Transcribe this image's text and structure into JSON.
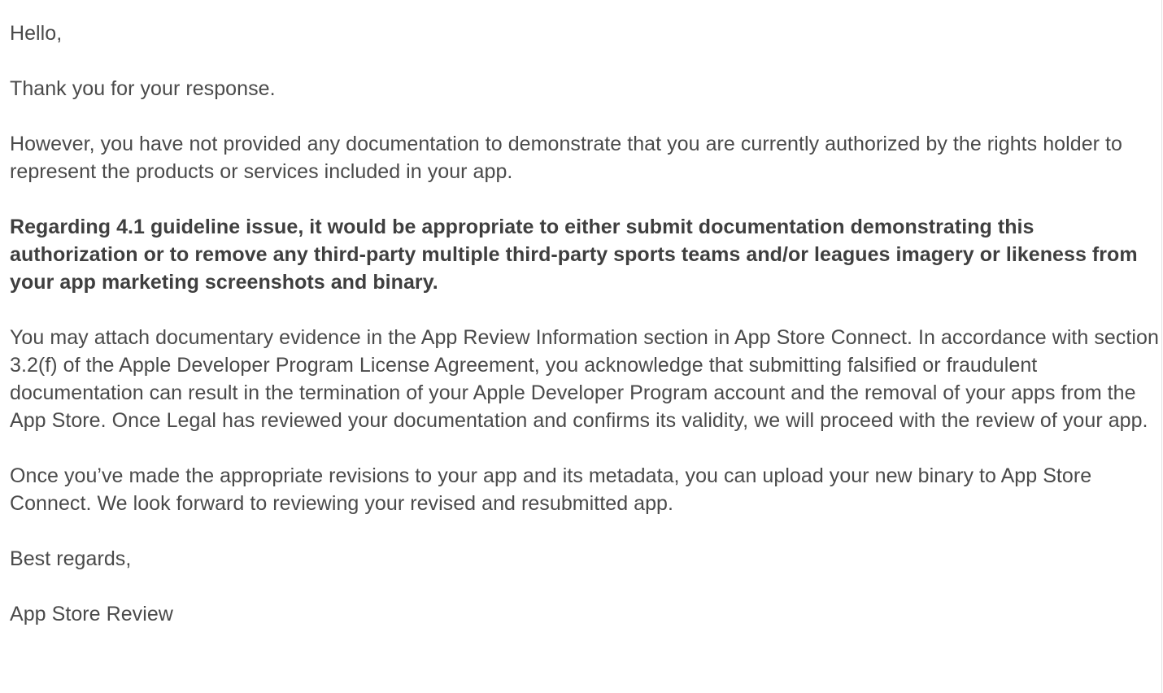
{
  "message": {
    "greeting": "Hello,",
    "thanks": "Thank you for your response.",
    "no_documentation": "However, you have not provided any documentation to demonstrate that you are currently authorized by the rights holder to represent the products or services included in your app.",
    "guideline_issue": "Regarding 4.1 guideline issue, it would be appropriate to either submit documentation demonstrating this authorization or to remove any third-party multiple third-party sports teams and/or leagues imagery or likeness from your app marketing screenshots and binary.",
    "attach_evidence": "You may attach documentary evidence in the App Review Information section in App Store Connect. In accordance with section 3.2(f) of the Apple Developer Program License Agreement, you acknowledge that submitting falsified or fraudulent documentation can result in the termination of your Apple Developer Program account and the removal of your apps from the App Store. Once Legal has reviewed your documentation and confirms its validity, we will proceed with the review of your app.",
    "revisions": "Once you’ve made the appropriate revisions to your app and its metadata, you can upload your new binary to App Store Connect. We look forward to reviewing your revised and resubmitted app.",
    "closing": "Best regards,",
    "signature": "App Store Review"
  },
  "colors": {
    "text": "#4a4a4a",
    "bold_text": "#3f3f3f",
    "background": "#ffffff",
    "divider": "#e4e4e4"
  }
}
